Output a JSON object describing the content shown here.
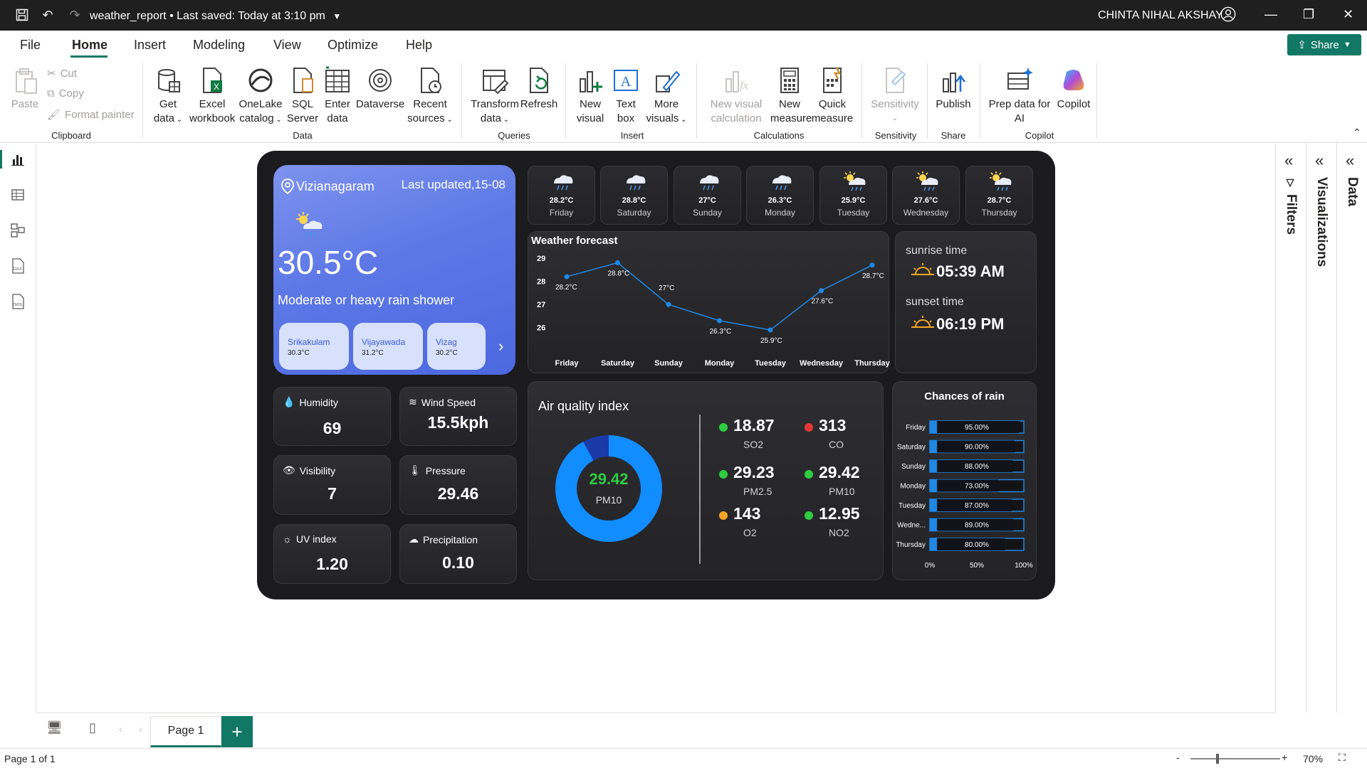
{
  "app": {
    "doc_title": "weather_report",
    "save_status": "Last saved: Today at 3:10 pm",
    "user_name": "CHINTA NIHAL AKSHAY"
  },
  "menu": {
    "tabs": [
      "File",
      "Home",
      "Insert",
      "Modeling",
      "View",
      "Optimize",
      "Help"
    ],
    "share_label": "Share"
  },
  "ribbon": {
    "paste": "Paste",
    "cut": "Cut",
    "copy": "Copy",
    "format_painter": "Format painter",
    "get_data": "Get data",
    "excel_workbook": "Excel workbook",
    "onelake_catalog": "OneLake catalog",
    "sql_server": "SQL Server",
    "enter_data": "Enter data",
    "dataverse": "Dataverse",
    "recent_sources": "Recent sources",
    "transform_data": "Transform data",
    "refresh": "Refresh",
    "new_visual": "New visual",
    "text_box": "Text box",
    "more_visuals": "More visuals",
    "new_visual_calculation": "New visual calculation",
    "new_measure": "New measure",
    "quick_measure": "Quick measure",
    "sensitivity": "Sensitivity",
    "publish": "Publish",
    "prep_data_ai": "Prep data for AI",
    "copilot": "Copilot",
    "groups": {
      "clipboard": "Clipboard",
      "data": "Data",
      "queries": "Queries",
      "insert": "Insert",
      "calculations": "Calculations",
      "sensitivity": "Sensitivity",
      "share": "Share",
      "copilot": "Copilot"
    }
  },
  "panes": {
    "filters": "Filters",
    "visualizations": "Visualizations",
    "data": "Data"
  },
  "pages": {
    "page_tab": "Page 1",
    "add": "+",
    "status": "Page 1 of 1",
    "zoom": "70%",
    "zoom_minus": "-",
    "zoom_plus": "+"
  },
  "report": {
    "location": {
      "city": "Vizianagaram",
      "updated": "Last updated,15-08",
      "temp": "30.5°C",
      "condition": "Moderate or heavy rain shower",
      "cities": [
        {
          "name": "Srikakulam",
          "temp": "30.3°C"
        },
        {
          "name": "Vijayawada",
          "temp": "31.2°C"
        },
        {
          "name": "Vizag",
          "temp": "30.2°C"
        }
      ]
    },
    "forecast_days": [
      {
        "temp": "28.2°C",
        "day": "Friday",
        "icon": "rain-cloud-icon"
      },
      {
        "temp": "28.8°C",
        "day": "Saturday",
        "icon": "rain-cloud-icon"
      },
      {
        "temp": "27°C",
        "day": "Sunday",
        "icon": "rain-cloud-icon"
      },
      {
        "temp": "26.3°C",
        "day": "Monday",
        "icon": "rain-cloud-icon"
      },
      {
        "temp": "25.9°C",
        "day": "Tuesday",
        "icon": "sun-cloud-icon"
      },
      {
        "temp": "27.6°C",
        "day": "Wednesday",
        "icon": "sun-cloud-icon"
      },
      {
        "temp": "28.7°C",
        "day": "Thursday",
        "icon": "sun-cloud-icon"
      }
    ],
    "sun": {
      "sunrise_label": "sunrise time",
      "sunrise": "05:39 AM",
      "sunset_label": "sunset time",
      "sunset": "06:19 PM"
    },
    "stats": {
      "humidity_label": "Humidity",
      "humidity": "69",
      "wind_label": "Wind Speed",
      "wind": "15.5kph",
      "visibility_label": "Visibility",
      "visibility": "7",
      "pressure_label": "Pressure",
      "pressure": "29.46",
      "uv_label": "UV index",
      "uv": "1.20",
      "precip_label": "Precipitation",
      "precip": "0.10"
    },
    "aqi": {
      "title": "Air quality index",
      "center_value": "29.42",
      "center_label": "PM10",
      "donut_fraction": 0.92,
      "items": [
        {
          "value": "18.87",
          "name": "SO2",
          "color": "#2ecc40"
        },
        {
          "value": "313",
          "name": "CO",
          "color": "#e53935"
        },
        {
          "value": "29.23",
          "name": "PM2.5",
          "color": "#2ecc40"
        },
        {
          "value": "29.42",
          "name": "PM10",
          "color": "#2ecc40"
        },
        {
          "value": "143",
          "name": "O2",
          "color": "#f5a623"
        },
        {
          "value": "12.95",
          "name": "NO2",
          "color": "#2ecc40"
        }
      ]
    }
  },
  "chart_data": [
    {
      "type": "line",
      "title": "Weather forecast",
      "categories": [
        "Friday",
        "Saturday",
        "Sunday",
        "Monday",
        "Tuesday",
        "Wednesday",
        "Thursday"
      ],
      "values": [
        28.2,
        28.8,
        27,
        26.3,
        25.9,
        27.6,
        28.7
      ],
      "data_labels": [
        "28.2°C",
        "28.8°C",
        "27°C",
        "26.3°C",
        "25.9°C",
        "27.6°C",
        "28.7°C"
      ],
      "yticks": [
        26,
        27,
        28,
        29
      ],
      "ylim": [
        25.9,
        29
      ],
      "color": "#1e88e5"
    },
    {
      "type": "bar",
      "title": "Chances of rain",
      "categories": [
        "Friday",
        "Saturday",
        "Sunday",
        "Monday",
        "Tuesday",
        "Wedne...",
        "Thursday"
      ],
      "values": [
        95,
        90,
        88,
        73,
        87,
        89,
        80
      ],
      "data_labels": [
        "95.00%",
        "90.00%",
        "88.00%",
        "73.00%",
        "87.00%",
        "89.00%",
        "80.00%"
      ],
      "xticks": [
        "0%",
        "50%",
        "100%"
      ],
      "xlim": [
        0,
        100
      ],
      "color": "#1e88e5"
    }
  ]
}
